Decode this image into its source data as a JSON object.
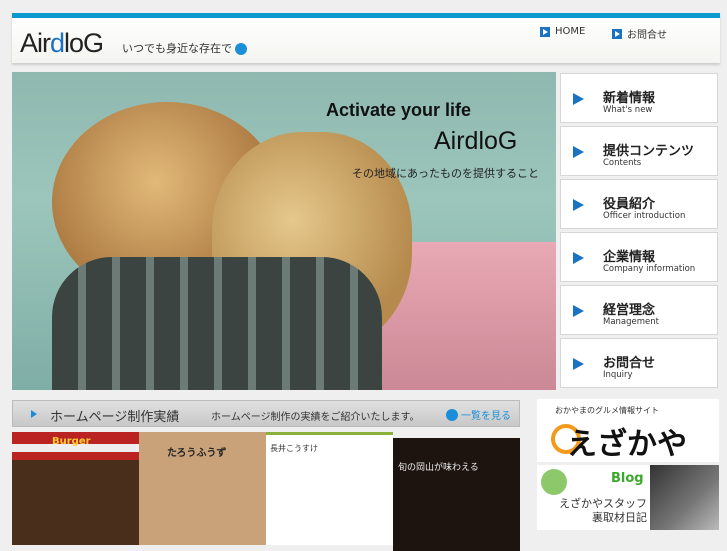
{
  "header": {
    "logo_pre": "Air",
    "logo_d": "d",
    "logo_post": "loG",
    "tagline": "いつでも身近な存在で",
    "links": [
      {
        "label": "HOME"
      },
      {
        "label": "お問合せ"
      }
    ]
  },
  "hero": {
    "line1": "Activate your life",
    "line2": "AirdloG",
    "line3": "その地域にあったものを提供すること"
  },
  "nav": [
    {
      "ja": "新着情報",
      "en": "What's new"
    },
    {
      "ja": "提供コンテンツ",
      "en": "Contents"
    },
    {
      "ja": "役員紹介",
      "en": "Officer introduction"
    },
    {
      "ja": "企業情報",
      "en": "Company information"
    },
    {
      "ja": "経営理念",
      "en": "Management"
    },
    {
      "ja": "お問合せ",
      "en": "Inquiry"
    }
  ],
  "works": {
    "title": "ホームページ制作実績",
    "subtitle": "ホームページ制作の実績をご紹介いたします。",
    "link": "一覧を見る",
    "thumbs": [
      {
        "label": "Burger"
      },
      {
        "label": "たろうふうず"
      },
      {
        "label": "長井こうすけ"
      },
      {
        "label": "旬の岡山が味わえる"
      }
    ]
  },
  "ads": {
    "ezakaya_sub": "おかやまのグルメ情報サイト",
    "ezakaya": "えざかや",
    "blog": "Blog",
    "blog_text1": "えざかやスタッフ",
    "blog_text2": "裏取材日記"
  },
  "colors": {
    "accent": "#0b9ad0",
    "nav_arrow": "#1a72c4"
  }
}
